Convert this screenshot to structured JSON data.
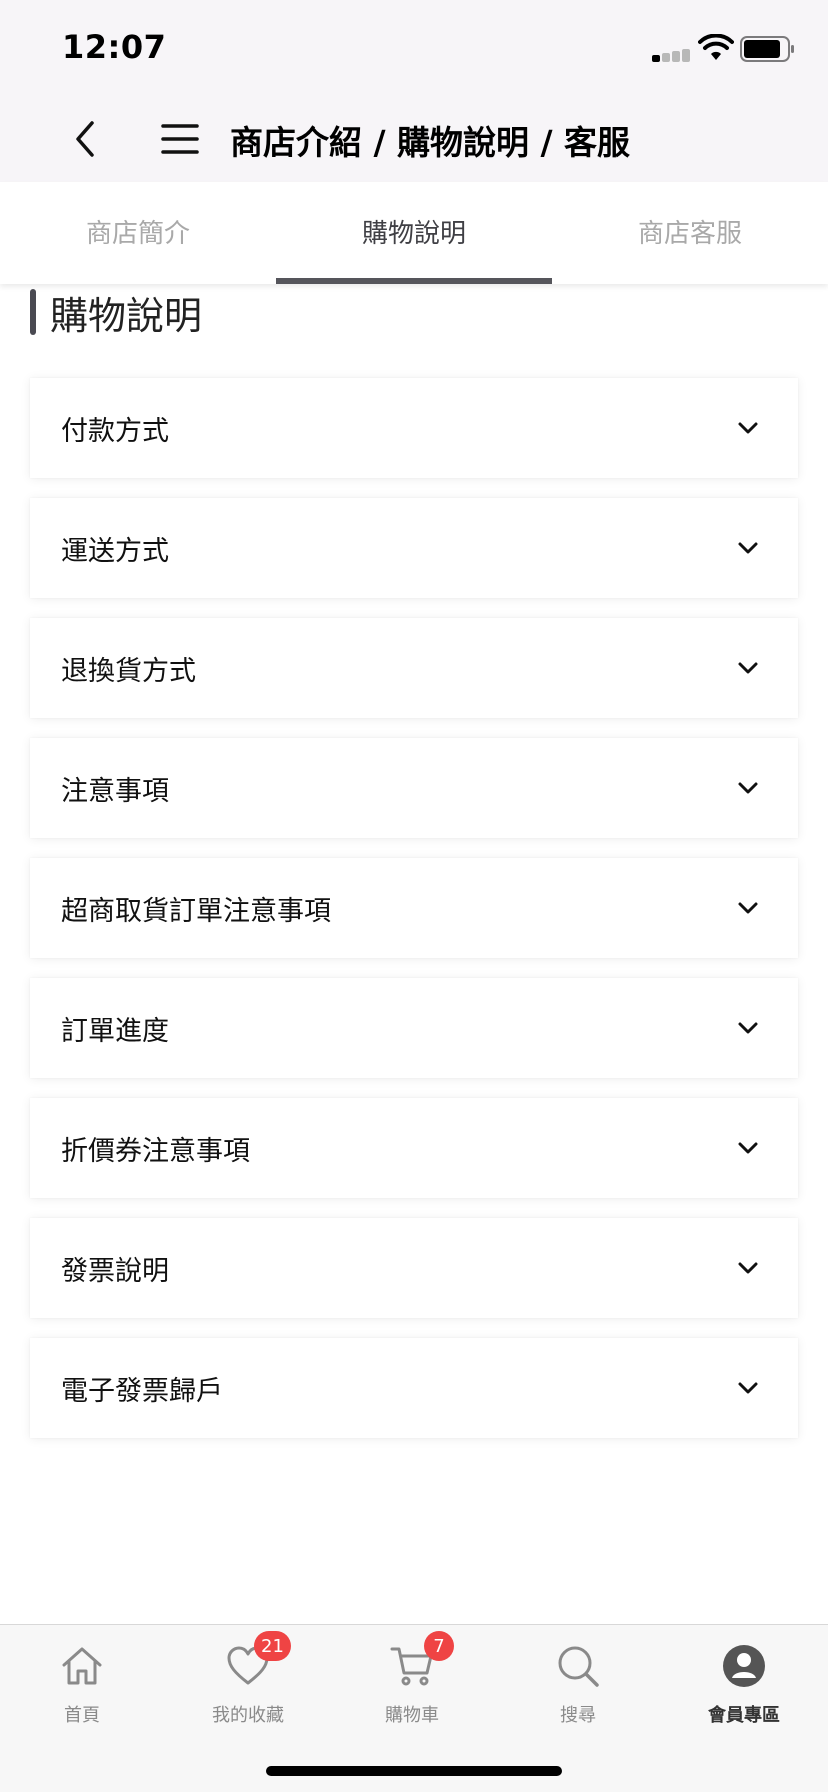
{
  "status_bar": {
    "time": "12:07",
    "signal_icon": "cellular-signal-icon",
    "wifi_icon": "wifi-icon",
    "battery_icon": "battery-icon"
  },
  "header": {
    "title": "商店介紹 / 購物說明 / 客服",
    "back_icon": "chevron-left-icon",
    "menu_icon": "hamburger-menu-icon"
  },
  "tabs": [
    {
      "label": "商店簡介",
      "active": false
    },
    {
      "label": "購物說明",
      "active": true
    },
    {
      "label": "商店客服",
      "active": false
    }
  ],
  "section": {
    "title": "購物說明"
  },
  "accordion": [
    {
      "label": "付款方式"
    },
    {
      "label": "運送方式"
    },
    {
      "label": "退換貨方式"
    },
    {
      "label": "注意事項"
    },
    {
      "label": "超商取貨訂單注意事項"
    },
    {
      "label": "訂單進度"
    },
    {
      "label": "折價券注意事項"
    },
    {
      "label": "發票說明"
    },
    {
      "label": "電子發票歸戶"
    }
  ],
  "tab_bar": {
    "items": [
      {
        "label": "首頁",
        "icon": "home-icon"
      },
      {
        "label": "我的收藏",
        "icon": "heart-icon",
        "badge": "21"
      },
      {
        "label": "購物車",
        "icon": "cart-icon",
        "badge": "7"
      },
      {
        "label": "搜尋",
        "icon": "search-icon"
      },
      {
        "label": "會員專區",
        "icon": "user-avatar-icon",
        "active": true
      }
    ]
  },
  "colors": {
    "header_bg": "#f7f5f8",
    "tab_active": "#3f3f44",
    "tab_inactive": "#a9a9a9",
    "badge": "#ef4444"
  }
}
